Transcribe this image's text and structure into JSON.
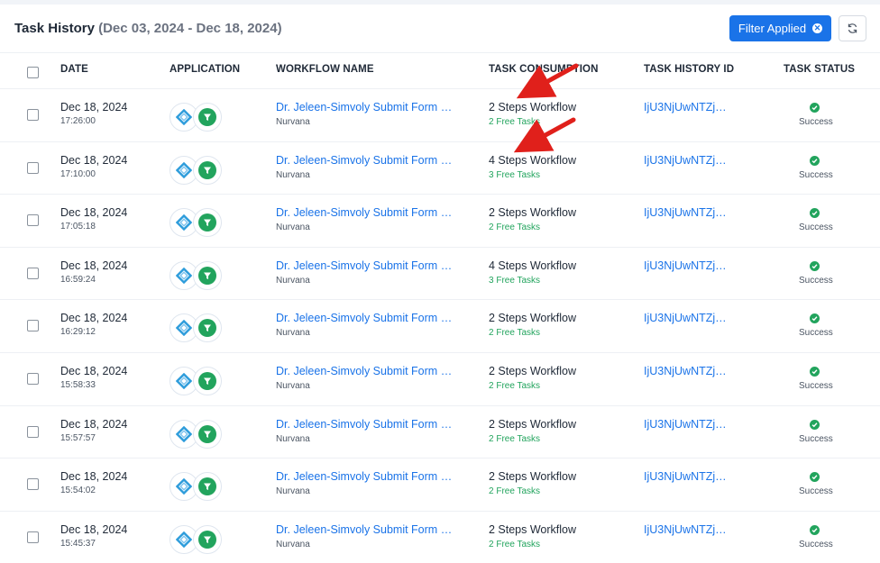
{
  "header": {
    "title": "Task History",
    "date_range": "(Dec 03, 2024 - Dec 18, 2024)",
    "filter_button": "Filter Applied",
    "filter_clear_icon": "close-circle-icon",
    "refresh_icon": "refresh-icon"
  },
  "columns": {
    "date": "DATE",
    "application": "APPLICATION",
    "workflow_name": "WORKFLOW NAME",
    "task_consumption": "TASK CONSUMPTION",
    "task_history_id": "TASK HISTORY ID",
    "task_status": "TASK STATUS"
  },
  "rows": [
    {
      "date": "Dec 18, 2024",
      "time": "17:26:00",
      "workflow": "Dr. Jeleen-Simvoly Submit Form (…",
      "workflow_app": "Nurvana",
      "steps": "2 Steps Workflow",
      "free_tasks": "2 Free Tasks",
      "history_id": "IjU3NjUwNTZj…",
      "status": "Success"
    },
    {
      "date": "Dec 18, 2024",
      "time": "17:10:00",
      "workflow": "Dr. Jeleen-Simvoly Submit Form (…",
      "workflow_app": "Nurvana",
      "steps": "4 Steps Workflow",
      "free_tasks": "3 Free Tasks",
      "history_id": "IjU3NjUwNTZj…",
      "status": "Success"
    },
    {
      "date": "Dec 18, 2024",
      "time": "17:05:18",
      "workflow": "Dr. Jeleen-Simvoly Submit Form (…",
      "workflow_app": "Nurvana",
      "steps": "2 Steps Workflow",
      "free_tasks": "2 Free Tasks",
      "history_id": "IjU3NjUwNTZj…",
      "status": "Success"
    },
    {
      "date": "Dec 18, 2024",
      "time": "16:59:24",
      "workflow": "Dr. Jeleen-Simvoly Submit Form (…",
      "workflow_app": "Nurvana",
      "steps": "4 Steps Workflow",
      "free_tasks": "3 Free Tasks",
      "history_id": "IjU3NjUwNTZj…",
      "status": "Success"
    },
    {
      "date": "Dec 18, 2024",
      "time": "16:29:12",
      "workflow": "Dr. Jeleen-Simvoly Submit Form (…",
      "workflow_app": "Nurvana",
      "steps": "2 Steps Workflow",
      "free_tasks": "2 Free Tasks",
      "history_id": "IjU3NjUwNTZj…",
      "status": "Success"
    },
    {
      "date": "Dec 18, 2024",
      "time": "15:58:33",
      "workflow": "Dr. Jeleen-Simvoly Submit Form (…",
      "workflow_app": "Nurvana",
      "steps": "2 Steps Workflow",
      "free_tasks": "2 Free Tasks",
      "history_id": "IjU3NjUwNTZj…",
      "status": "Success"
    },
    {
      "date": "Dec 18, 2024",
      "time": "15:57:57",
      "workflow": "Dr. Jeleen-Simvoly Submit Form (…",
      "workflow_app": "Nurvana",
      "steps": "2 Steps Workflow",
      "free_tasks": "2 Free Tasks",
      "history_id": "IjU3NjUwNTZj…",
      "status": "Success"
    },
    {
      "date": "Dec 18, 2024",
      "time": "15:54:02",
      "workflow": "Dr. Jeleen-Simvoly Submit Form (…",
      "workflow_app": "Nurvana",
      "steps": "2 Steps Workflow",
      "free_tasks": "2 Free Tasks",
      "history_id": "IjU3NjUwNTZj…",
      "status": "Success"
    },
    {
      "date": "Dec 18, 2024",
      "time": "15:45:37",
      "workflow": "Dr. Jeleen-Simvoly Submit Form (…",
      "workflow_app": "Nurvana",
      "steps": "2 Steps Workflow",
      "free_tasks": "2 Free Tasks",
      "history_id": "IjU3NjUwNTZj…",
      "status": "Success"
    }
  ],
  "icons": {
    "application_1": "webhook-diamond-icon",
    "application_2": "filter-funnel-icon",
    "status": "check-circle-icon"
  },
  "colors": {
    "accent": "#1a73e8",
    "success": "#22a45d",
    "annotation_arrow": "#e0201b"
  }
}
